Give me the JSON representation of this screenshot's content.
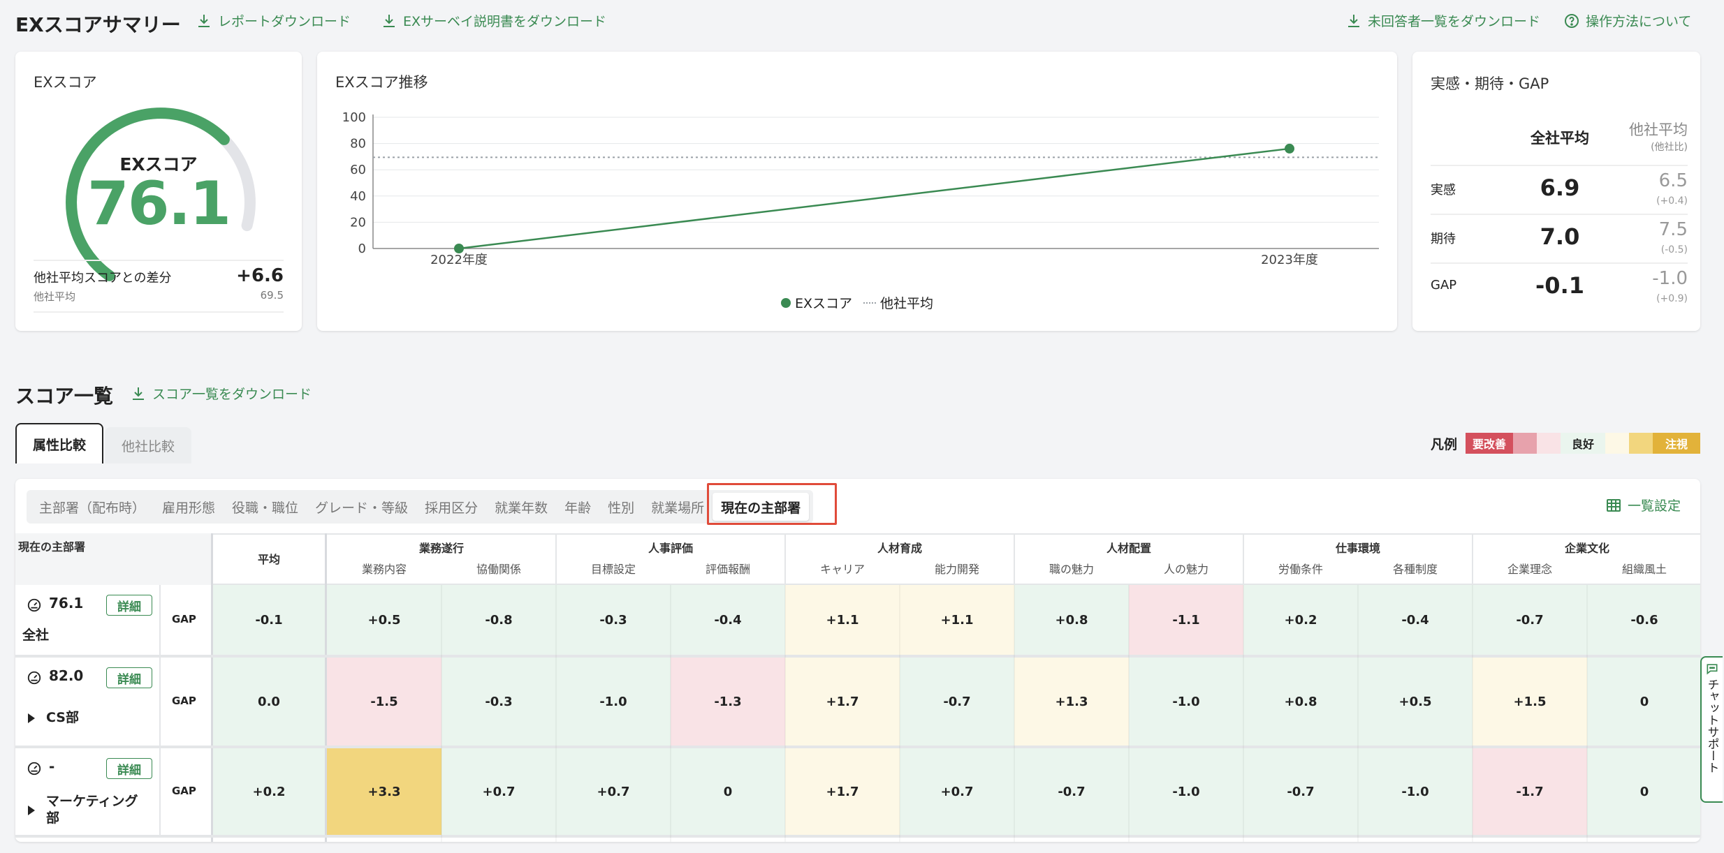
{
  "header": {
    "title": "EXスコアサマリー",
    "report_download": "レポートダウンロード",
    "survey_doc_download": "EXサーベイ説明書をダウンロード",
    "nonrespondent_download": "未回答者一覧をダウンロード",
    "how_to": "操作方法について"
  },
  "ex_card": {
    "title": "EXスコア",
    "gauge_label": "EXスコア",
    "score": "76.1",
    "score_fraction": 0.761,
    "diff_label": "他社平均スコアとの差分",
    "diff_value": "+6.6",
    "avg_label": "他社平均",
    "avg_value": "69.5"
  },
  "trend_card": {
    "title": "EXスコア推移",
    "legend_series": "EXスコア",
    "legend_avg": "他社平均"
  },
  "chart_data": {
    "type": "line",
    "x": [
      "2022年度",
      "2023年度"
    ],
    "series": [
      {
        "name": "EXスコア",
        "values": [
          0,
          76.1
        ]
      }
    ],
    "reference_line": {
      "name": "他社平均",
      "value": 69.5
    },
    "yticks": [
      "0",
      "20",
      "40",
      "60",
      "80",
      "100"
    ],
    "ylim": [
      0,
      100
    ],
    "legend_placement": "bottom",
    "colors": {
      "series": "#3a8a52",
      "reference": "#9aa0a6"
    }
  },
  "gap_card": {
    "title": "実感・期待・GAP",
    "col_company": "全社平均",
    "col_other": "他社平均",
    "col_other_sub": "(他社比)",
    "rows": [
      {
        "label": "実感",
        "value": "6.9",
        "other": "6.5",
        "diff": "(+0.4)"
      },
      {
        "label": "期待",
        "value": "7.0",
        "other": "7.5",
        "diff": "(-0.5)"
      },
      {
        "label": "GAP",
        "value": "-0.1",
        "other": "-1.0",
        "diff": "(+0.9)"
      }
    ]
  },
  "score_list": {
    "title": "スコア一覧",
    "download": "スコア一覧をダウンロード",
    "tab_attr": "属性比較",
    "tab_other": "他社比較",
    "legend_label": "凡例",
    "legend_bad": "要改善",
    "legend_good": "良好",
    "legend_caution": "注視",
    "subtabs": [
      "主部署（配布時）",
      "雇用形態",
      "役職・職位",
      "グレード・等級",
      "採用区分",
      "就業年数",
      "年齢",
      "性別",
      "就業場所",
      "現在の主部署"
    ],
    "list_settings": "一覧設定",
    "row_header": "現在の主部署",
    "avg_header": "平均",
    "groups": [
      "業務遂行",
      "人事評価",
      "人材育成",
      "人材配置",
      "仕事環境",
      "企業文化"
    ],
    "subcols": [
      "業務内容",
      "協働関係",
      "目標設定",
      "評価報酬",
      "キャリア",
      "能力開発",
      "職の魅力",
      "人の魅力",
      "労働条件",
      "各種制度",
      "企業理念",
      "組織風土"
    ],
    "detail_label": "詳細",
    "gap_label": "GAP",
    "rows": [
      {
        "score": "76.1",
        "name": "全社",
        "avg": "-0.1",
        "cells": [
          "+0.5",
          "-0.8",
          "-0.3",
          "-0.4",
          "+1.1",
          "+1.1",
          "+0.8",
          "-1.1",
          "+0.2",
          "-0.4",
          "-0.7",
          "-0.6"
        ]
      },
      {
        "score": "82.0",
        "name": "CS部",
        "avg": "0.0",
        "cells": [
          "-1.5",
          "-0.3",
          "-1.0",
          "-1.3",
          "+1.7",
          "-0.7",
          "+1.3",
          "-1.0",
          "+0.8",
          "+0.5",
          "+1.5",
          "0"
        ]
      },
      {
        "score": "-",
        "name": "マーケティング部",
        "avg": "+0.2",
        "cells": [
          "+3.3",
          "+0.7",
          "+0.7",
          "0",
          "+1.7",
          "+0.7",
          "-0.7",
          "-1.0",
          "-0.7",
          "-1.0",
          "-1.7",
          "0"
        ]
      }
    ]
  },
  "chat_support": "チャットサポート"
}
